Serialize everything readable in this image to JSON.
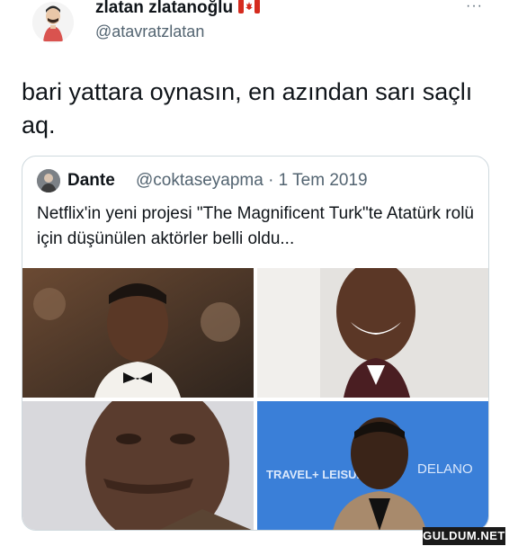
{
  "tweet": {
    "display_name": "zlatan zlatanoğlu",
    "flag_icon": "canada-flag-icon",
    "handle": "@atavratzlatan",
    "more_label": "···",
    "text": "bari yattara oynasın, en azından sarı saçlı aq."
  },
  "quote": {
    "name": "Dante",
    "meta": "@coktaseyapma · 1 Tem 2019",
    "text": "Netflix'in yeni projesi \"The Magnificent Turk\"te Atatürk rolü için düşünülen aktörler belli oldu...",
    "photos": [
      {
        "name": "photo-1"
      },
      {
        "name": "photo-2"
      },
      {
        "name": "photo-3"
      },
      {
        "name": "photo-4",
        "background_text_1": "TRAVEL+ LEISURE",
        "background_text_2": "DELANO"
      }
    ]
  },
  "watermark": "GULDUM.NET",
  "colors": {
    "text_primary": "#0f1419",
    "text_secondary": "#536471",
    "border": "#cfd9de",
    "flag_red": "#d52b1e"
  }
}
